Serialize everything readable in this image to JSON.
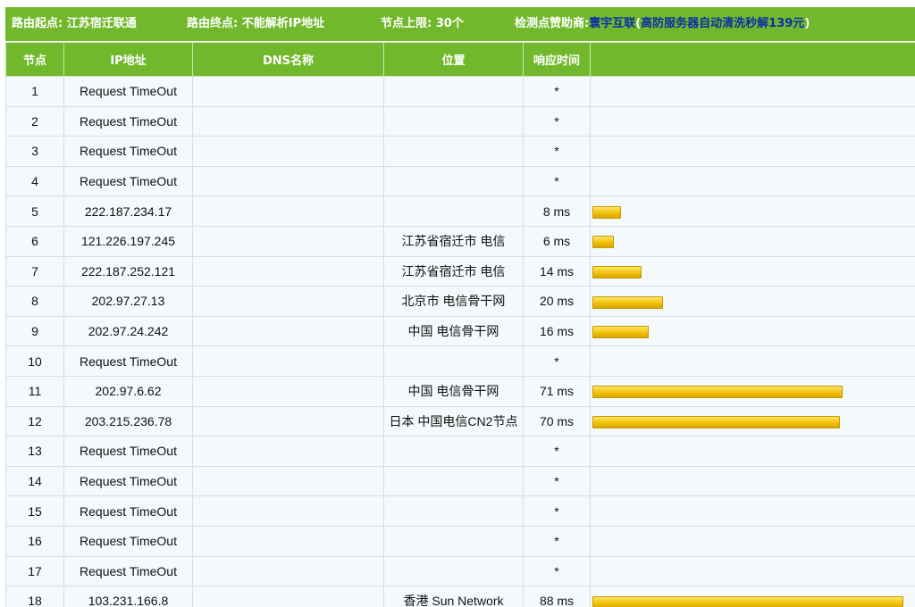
{
  "header": {
    "start_label": "路由起点:",
    "start_value": "江苏宿迁联通",
    "end_label": "路由终点:",
    "end_value": "不能解析IP地址",
    "limit_label": "节点上限:",
    "limit_value": "30个",
    "sponsor_label": "检测点赞助商:",
    "sponsor_name": "寰宇互联",
    "sponsor_ad": "高防服务器自动清洗秒解139元",
    "paren_open": "(",
    "paren_close": ")"
  },
  "columns": [
    "节点",
    "IP地址",
    "DNS名称",
    "位置",
    "响应时间",
    ""
  ],
  "colors": {
    "header_green": "#72b82c",
    "link_blue": "#0b2ea6",
    "bar_yellow": "#f2c20a"
  },
  "rows": [
    {
      "node": "1",
      "ip": "Request TimeOut",
      "dns": "",
      "location": "",
      "response": "*",
      "ms": 0
    },
    {
      "node": "2",
      "ip": "Request TimeOut",
      "dns": "",
      "location": "",
      "response": "*",
      "ms": 0
    },
    {
      "node": "3",
      "ip": "Request TimeOut",
      "dns": "",
      "location": "",
      "response": "*",
      "ms": 0
    },
    {
      "node": "4",
      "ip": "Request TimeOut",
      "dns": "",
      "location": "",
      "response": "*",
      "ms": 0
    },
    {
      "node": "5",
      "ip": "222.187.234.17",
      "dns": "",
      "location": "",
      "response": "8 ms",
      "ms": 8
    },
    {
      "node": "6",
      "ip": "121.226.197.245",
      "dns": "",
      "location": "江苏省宿迁市 电信",
      "response": "6 ms",
      "ms": 6
    },
    {
      "node": "7",
      "ip": "222.187.252.121",
      "dns": "",
      "location": "江苏省宿迁市 电信",
      "response": "14 ms",
      "ms": 14
    },
    {
      "node": "8",
      "ip": "202.97.27.13",
      "dns": "",
      "location": "北京市 电信骨干网",
      "response": "20 ms",
      "ms": 20
    },
    {
      "node": "9",
      "ip": "202.97.24.242",
      "dns": "",
      "location": "中国 电信骨干网",
      "response": "16 ms",
      "ms": 16
    },
    {
      "node": "10",
      "ip": "Request TimeOut",
      "dns": "",
      "location": "",
      "response": "*",
      "ms": 0
    },
    {
      "node": "11",
      "ip": "202.97.6.62",
      "dns": "",
      "location": "中国 电信骨干网",
      "response": "71 ms",
      "ms": 71
    },
    {
      "node": "12",
      "ip": "203.215.236.78",
      "dns": "",
      "location": "日本 中国电信CN2节点",
      "response": "70 ms",
      "ms": 70
    },
    {
      "node": "13",
      "ip": "Request TimeOut",
      "dns": "",
      "location": "",
      "response": "*",
      "ms": 0
    },
    {
      "node": "14",
      "ip": "Request TimeOut",
      "dns": "",
      "location": "",
      "response": "*",
      "ms": 0
    },
    {
      "node": "15",
      "ip": "Request TimeOut",
      "dns": "",
      "location": "",
      "response": "*",
      "ms": 0
    },
    {
      "node": "16",
      "ip": "Request TimeOut",
      "dns": "",
      "location": "",
      "response": "*",
      "ms": 0
    },
    {
      "node": "17",
      "ip": "Request TimeOut",
      "dns": "",
      "location": "",
      "response": "*",
      "ms": 0
    },
    {
      "node": "18",
      "ip": "103.231.166.8",
      "dns": "",
      "location": "香港 Sun Network",
      "response": "88 ms",
      "ms": 88
    }
  ]
}
